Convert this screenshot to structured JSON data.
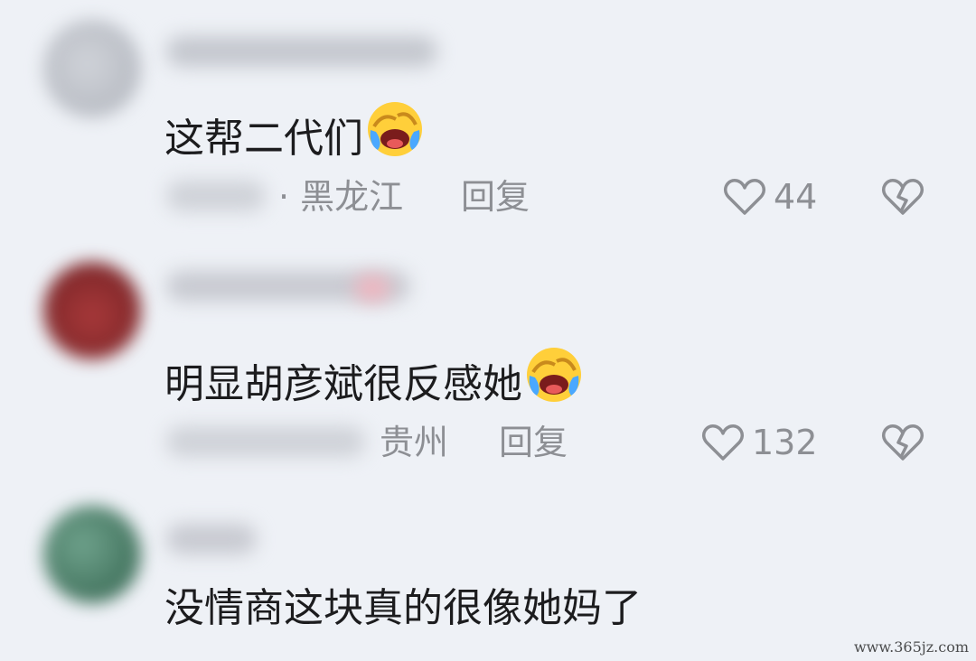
{
  "comments": [
    {
      "avatar_color": "#b9bcc3",
      "text": "这帮二代们",
      "emoji_icon": "laughing-crying-face-icon",
      "location": "黑龙江",
      "reply_label": "回复",
      "likes": "44"
    },
    {
      "avatar_color": "#8e2d2f",
      "text": "明显胡彦斌很反感她",
      "emoji_icon": "laughing-crying-face-icon",
      "location": "贵州",
      "reply_label": "回复",
      "likes": "132"
    },
    {
      "avatar_color": "#3f7a62",
      "text": "没情商这块真的很像她妈了"
    }
  ],
  "watermark": "www.365jz.com",
  "colors": {
    "background": "#eef1f6",
    "text_primary": "#1c1c1e",
    "text_secondary": "#8d8f94"
  }
}
